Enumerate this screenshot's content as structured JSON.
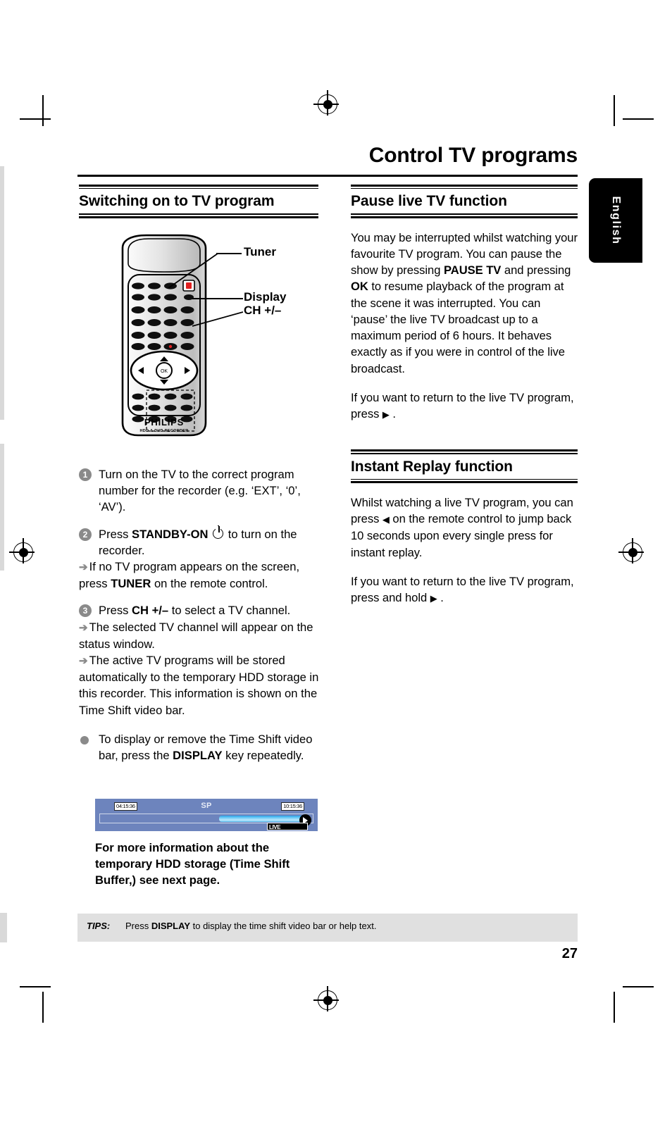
{
  "header": {
    "title_part1": "Control ",
    "title_part2": "TV programs",
    "language_tab": "English",
    "page_number": "27"
  },
  "left_column": {
    "section": {
      "heading_part1": "Switching on to ",
      "heading_part2": "TV program"
    },
    "illustration": {
      "device": "philips-remote-control",
      "brand": "PHILIPS",
      "brand_sub": "HDD & DVD RECORDER",
      "callouts": [
        {
          "label": "Tuner"
        },
        {
          "label": "Display"
        },
        {
          "label": "CH +/–"
        }
      ]
    },
    "steps": [
      {
        "number": "1",
        "text": "Turn on the TV to the correct program number for the recorder (e.g. ‘EXT’, ‘0’, ‘AV’)."
      },
      {
        "number": "2",
        "lead_in": "Press ",
        "bold_1": "STANDBY-ON",
        "after_icon": " to turn on the recorder.",
        "results": [
          {
            "pre": "If no TV program appears on the screen, press ",
            "bold": "TUNER",
            "post": " on the remote control."
          }
        ]
      },
      {
        "number": "3",
        "lead_in": "Press ",
        "bold_1": "CH +/–",
        "after_icon": " to select a TV channel.",
        "results": [
          {
            "pre": "The selected TV channel will appear on the status window.",
            "bold": "",
            "post": ""
          },
          {
            "pre": "The active TV programs will be stored automatically to the temporary HDD storage in this recorder. This information is shown on the Time Shift video bar.",
            "bold": "",
            "post": ""
          }
        ]
      }
    ],
    "bullet": {
      "pre": "To display or remove the Time Shift video bar, press the ",
      "bold": "DISPLAY",
      "post": "  key repeatedly."
    },
    "time_shift_bar": {
      "start_time": "04:15:36",
      "end_time": "10:15:36",
      "record_mode": "SP",
      "live_badge": "LIVE",
      "progress_percent": 56
    },
    "closing_note": "For more information about the temporary HDD storage (Time Shift Buffer,) see next page."
  },
  "right_column": {
    "pause_section": {
      "heading_part1": "Pause live ",
      "heading_part2": "TV function",
      "paragraph_1_a": "You may be interrupted whilst watching your favourite TV program.  You can pause the show by pressing ",
      "paragraph_1_b": "PAUSE TV",
      "paragraph_1_c": " and pressing ",
      "paragraph_1_d": "OK",
      "paragraph_1_e": " to resume playback of the program at the scene it was interrupted. You can ‘pause’ the live TV broadcast up to a maximum period of 6 hours. It behaves exactly as if you were in control of the live broadcast.",
      "paragraph_2_a": "If you want to return to the live TV program, press ",
      "paragraph_2_icon": "▶",
      "paragraph_2_b": " ."
    },
    "replay_section": {
      "heading": "Instant Replay function",
      "paragraph_1_a": "Whilst watching a live TV program, you can press ",
      "paragraph_1_icon": "◀",
      "paragraph_1_b": " on the remote control to jump back 10 seconds upon every single press for instant replay.",
      "paragraph_2_a": "If you want to return to the live TV program, press and hold ",
      "paragraph_2_icon": "▶",
      "paragraph_2_b": " ."
    }
  },
  "footer": {
    "tips_label": "TIPS:",
    "tips_pre": "Press ",
    "tips_bold": "DISPLAY",
    "tips_post": " to display the time shift video bar or help text."
  },
  "colors": {
    "accent_blue": "#6d84bd",
    "bar_fill": "#7fd2f7",
    "tips_background": "#e0e0e0",
    "step_marker": "#8a8a8a"
  }
}
